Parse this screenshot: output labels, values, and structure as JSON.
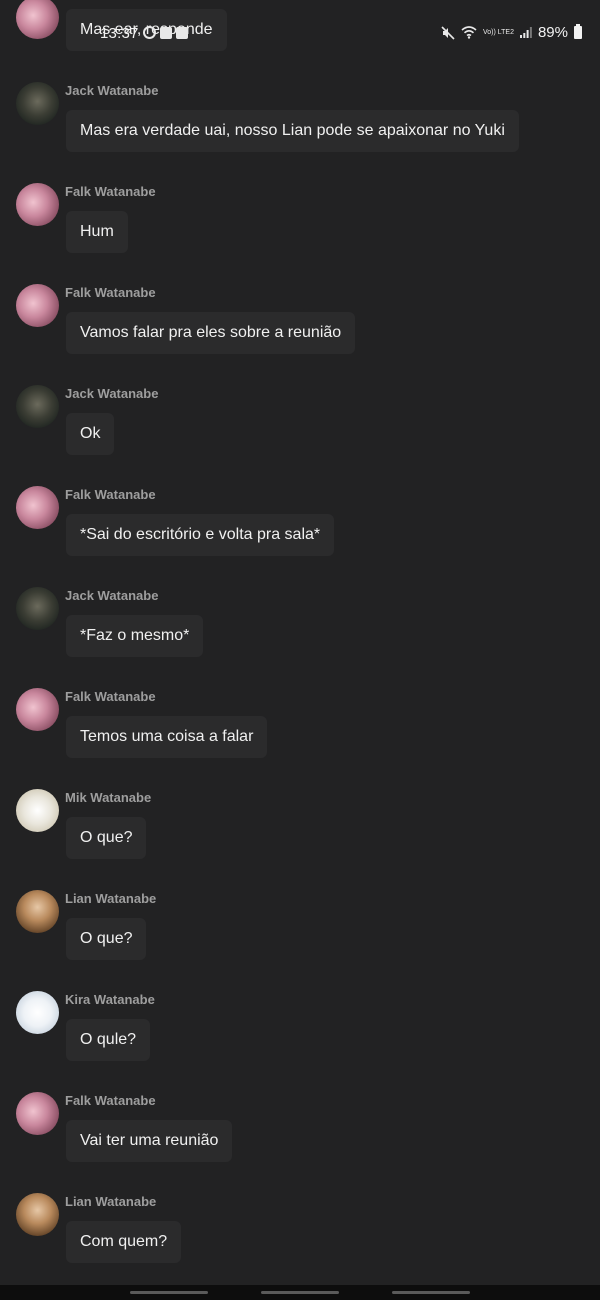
{
  "status_bar": {
    "time": "13:37",
    "battery": "89%",
    "network": "Vo)) LTE2"
  },
  "messages": [
    {
      "name": "",
      "avatar": "falk",
      "text": "Mas ear, responde"
    },
    {
      "name": "Jack Watanabe",
      "avatar": "jack",
      "text": "Mas era verdade uai, nosso Lian pode se apaixonar no Yuki"
    },
    {
      "name": "Falk Watanabe",
      "avatar": "falk",
      "text": "Hum"
    },
    {
      "name": "Falk Watanabe",
      "avatar": "falk",
      "text": "Vamos falar pra eles sobre a reunião"
    },
    {
      "name": "Jack Watanabe",
      "avatar": "jack",
      "text": "Ok"
    },
    {
      "name": "Falk Watanabe",
      "avatar": "falk",
      "text": "*Sai do escritório e volta pra sala*"
    },
    {
      "name": "Jack Watanabe",
      "avatar": "jack",
      "text": "*Faz o mesmo*"
    },
    {
      "name": "Falk Watanabe",
      "avatar": "falk",
      "text": "Temos uma coisa a falar"
    },
    {
      "name": "Mik Watanabe",
      "avatar": "mik",
      "text": "O que?"
    },
    {
      "name": "Lian Watanabe",
      "avatar": "lian",
      "text": "O que?"
    },
    {
      "name": "Kira Watanabe",
      "avatar": "kira",
      "text": "O qule?"
    },
    {
      "name": "Falk Watanabe",
      "avatar": "falk",
      "text": "Vai ter uma reunião"
    },
    {
      "name": "Lian Watanabe",
      "avatar": "lian",
      "text": "Com quem?"
    }
  ]
}
